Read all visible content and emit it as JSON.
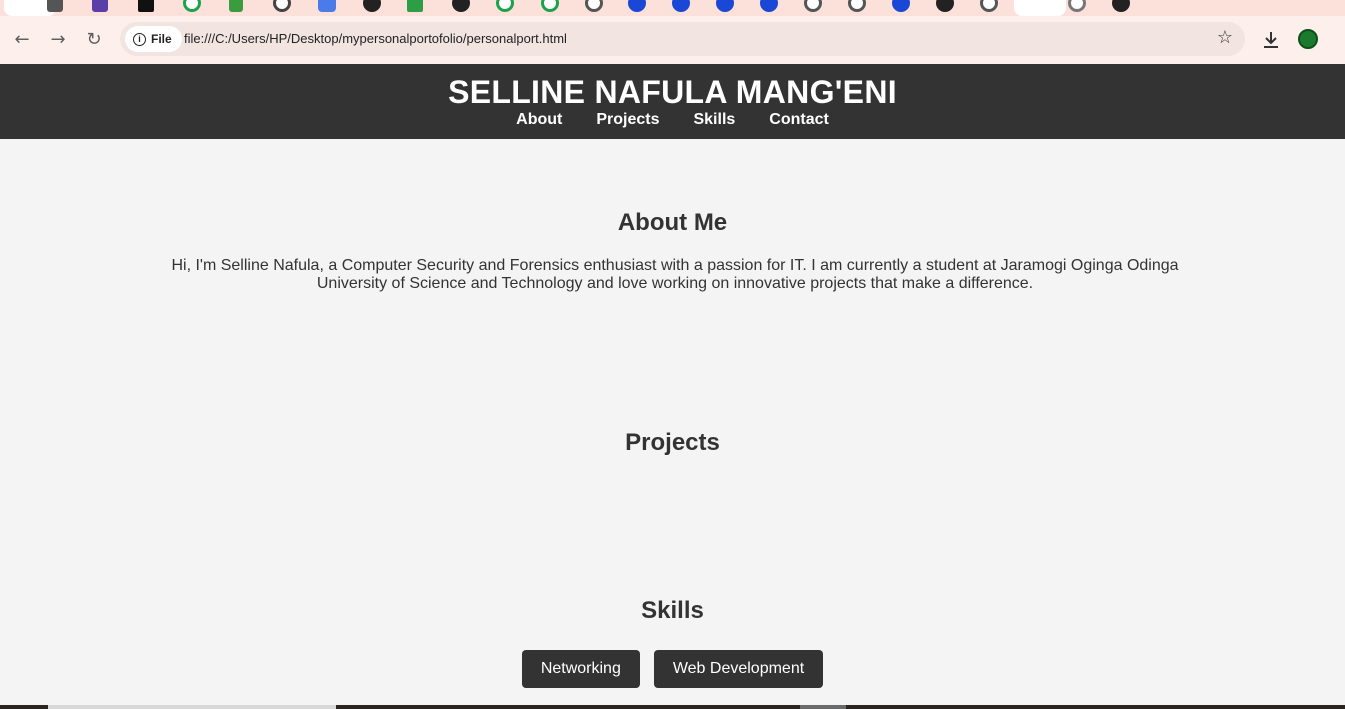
{
  "browser": {
    "site_chip_label": "File",
    "url": "file:///C:/Users/HP/Desktop/mypersonalportofolio/personalport.html"
  },
  "header": {
    "title": "SELLINE NAFULA MANG'ENI",
    "nav": [
      "About",
      "Projects",
      "Skills",
      "Contact"
    ]
  },
  "about": {
    "heading": "About Me",
    "text": "Hi, I'm Selline Nafula, a Computer Security and Forensics enthusiast with a passion for IT. I am currently a student at Jaramogi Oginga Odinga University of Science and Technology and love working on innovative projects that make a difference."
  },
  "projects": {
    "heading": "Projects"
  },
  "skills": {
    "heading": "Skills",
    "items": [
      "Networking",
      "Web Development"
    ]
  },
  "colors": {
    "header_bg": "#333333",
    "page_bg": "#f4f4f4",
    "skill_btn_bg": "#333333",
    "tabstrip_bg": "#fbe1d9"
  }
}
